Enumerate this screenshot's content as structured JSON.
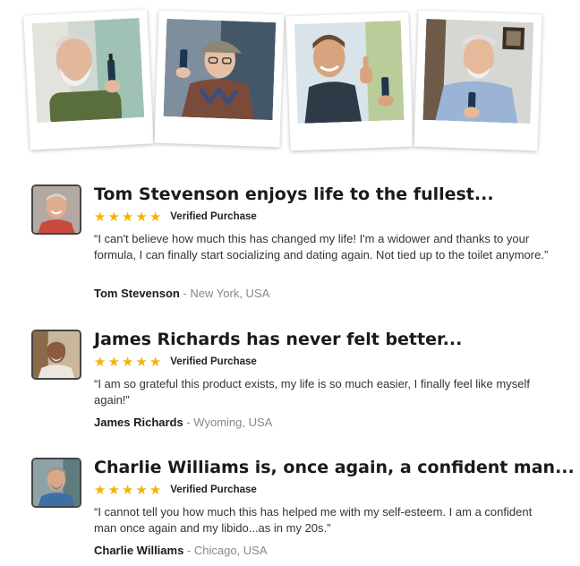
{
  "gallery": {
    "photos": [
      {
        "subject": "bearded man in green shirt holding dropper bottle"
      },
      {
        "subject": "older man in cap and argyle sweater holding bottle"
      },
      {
        "subject": "smiling man giving thumbs up with bottle"
      },
      {
        "subject": "grey-haired man in blue shirt holding bottle"
      }
    ]
  },
  "reviews": [
    {
      "title": "Tom Stevenson enjoys life to the fullest...",
      "stars": 5,
      "verified": "Verified Purchase",
      "body": "“I can't believe how much this has changed my life! I'm a widower and thanks to your formula, I can finally start socializing and dating again. Not tied up to the toilet anymore.”",
      "name": "Tom Stevenson",
      "location": " - New York, USA"
    },
    {
      "title": "James Richards has never felt better...",
      "stars": 5,
      "verified": "Verified Purchase",
      "body": "“I am so grateful this product exists, my life is so much easier, I finally feel like myself again!”",
      "name": "James Richards",
      "location": " - Wyoming, USA"
    },
    {
      "title": "Charlie Williams is, once again, a confident man...",
      "stars": 5,
      "verified": "Verified Purchase",
      "body": "“I cannot tell you how much this has helped me with my self-esteem. I am a confident man once again and my libido...as in my 20s.”",
      "name": "Charlie Williams",
      "location": " - Chicago, USA"
    }
  ],
  "colors": {
    "star": "#f5b400",
    "title": "#1a1a1a",
    "muted": "#888888"
  },
  "icons": {
    "star": "star-icon"
  }
}
